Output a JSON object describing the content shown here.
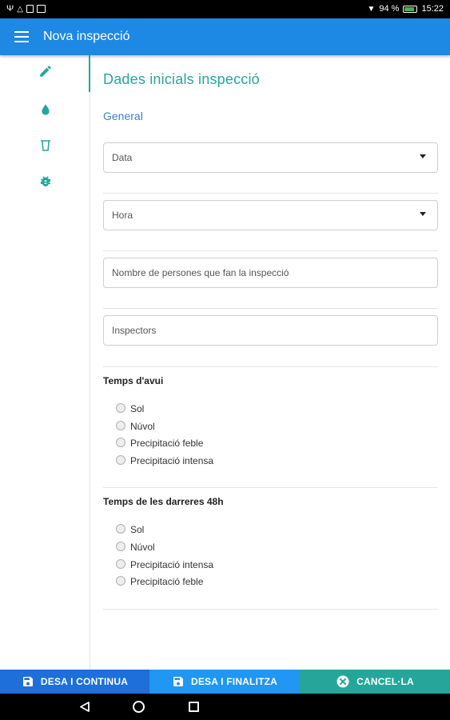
{
  "status_bar": {
    "battery_percent": "94 %",
    "time": "15:22"
  },
  "app_bar": {
    "title": "Nova inspecció"
  },
  "sidebar": {
    "items": [
      {
        "icon": "pencil-icon",
        "active": true
      },
      {
        "icon": "water-drop-icon",
        "active": false
      },
      {
        "icon": "beaker-icon",
        "active": false
      },
      {
        "icon": "bug-icon",
        "active": false
      }
    ]
  },
  "form": {
    "section_title": "Dades inicials inspecció",
    "subheading": "General",
    "fields": {
      "date_placeholder": "Data",
      "time_placeholder": "Hora",
      "persons_placeholder": "Nombre de persones que fan la inspecció",
      "inspectors_placeholder": "Inspectors"
    },
    "weather_today": {
      "label": "Temps d'avui",
      "options": [
        "Sol",
        "Núvol",
        "Precipitació feble",
        "Precipitació intensa"
      ]
    },
    "weather_48h": {
      "label": "Temps de les darreres 48h",
      "options": [
        "Sol",
        "Núvol",
        "Precipitació intensa",
        "Precipitació feble"
      ]
    }
  },
  "actions": {
    "save_continue": "DESA I CONTINUA",
    "save_finish": "DESA I FINALITZA",
    "cancel": "CANCEL·LA"
  },
  "colors": {
    "primary": "#1e88e5",
    "accent": "#26a69a",
    "subheading": "#3d7fd6"
  }
}
